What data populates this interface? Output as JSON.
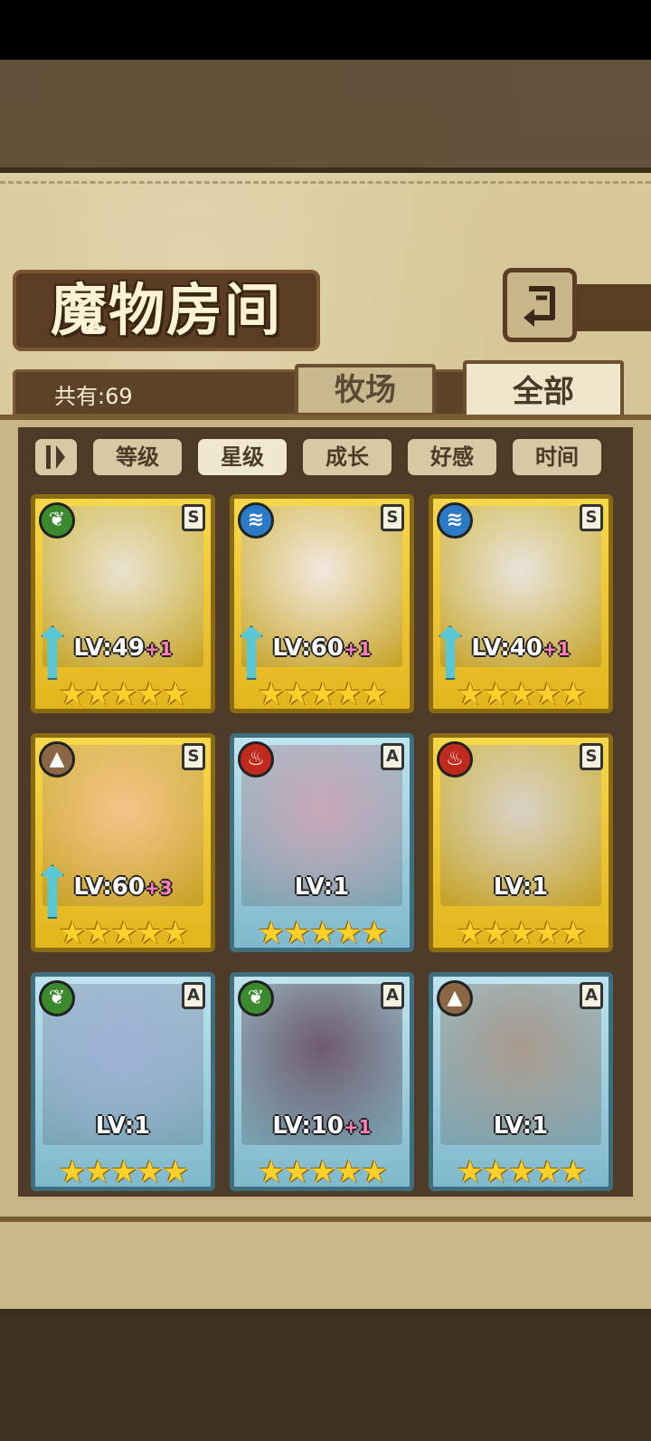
{
  "header": {
    "title": "魔物房间",
    "back_icon": "return-arrow-icon"
  },
  "summary": {
    "count_label": "共有:69"
  },
  "tabs": [
    {
      "label": "牧场"
    },
    {
      "label": "全部"
    }
  ],
  "sort": {
    "toggle_icon": "sort-direction-icon",
    "options": [
      {
        "label": "等级"
      },
      {
        "label": "星级"
      },
      {
        "label": "成长"
      },
      {
        "label": "好感"
      },
      {
        "label": "时间"
      }
    ],
    "selected": "星级"
  },
  "monsters": [
    {
      "level": "LV:49",
      "bonus": "+1",
      "rank": "S",
      "element": "nature",
      "frame": "gold",
      "stars": "★★★★★"
    },
    {
      "level": "LV:60",
      "bonus": "+1",
      "rank": "S",
      "element": "water",
      "frame": "gold",
      "stars": "★★★★★"
    },
    {
      "level": "LV:40",
      "bonus": "+1",
      "rank": "S",
      "element": "water",
      "frame": "gold",
      "stars": "★★★★★"
    },
    {
      "level": "LV:60",
      "bonus": "+3",
      "rank": "S",
      "element": "earth",
      "frame": "gold",
      "stars": "★★★★★"
    },
    {
      "level": "LV:1",
      "bonus": "",
      "rank": "A",
      "element": "fire",
      "frame": "blue",
      "stars": "★★★★★"
    },
    {
      "level": "LV:1",
      "bonus": "",
      "rank": "S",
      "element": "fire",
      "frame": "gold",
      "stars": "★★★★★"
    },
    {
      "level": "LV:1",
      "bonus": "",
      "rank": "A",
      "element": "nature",
      "frame": "blue",
      "stars": "★★★★★"
    },
    {
      "level": "LV:10",
      "bonus": "+1",
      "rank": "A",
      "element": "nature",
      "frame": "blue",
      "stars": "★★★★★"
    },
    {
      "level": "LV:1",
      "bonus": "",
      "rank": "A",
      "element": "earth",
      "frame": "blue",
      "stars": "★★★★★"
    }
  ],
  "colors": {
    "gold_frame": "#e3b51c",
    "blue_frame": "#7fb9cc",
    "parchment": "#cbb886",
    "panel_dark": "#4e3c28"
  }
}
